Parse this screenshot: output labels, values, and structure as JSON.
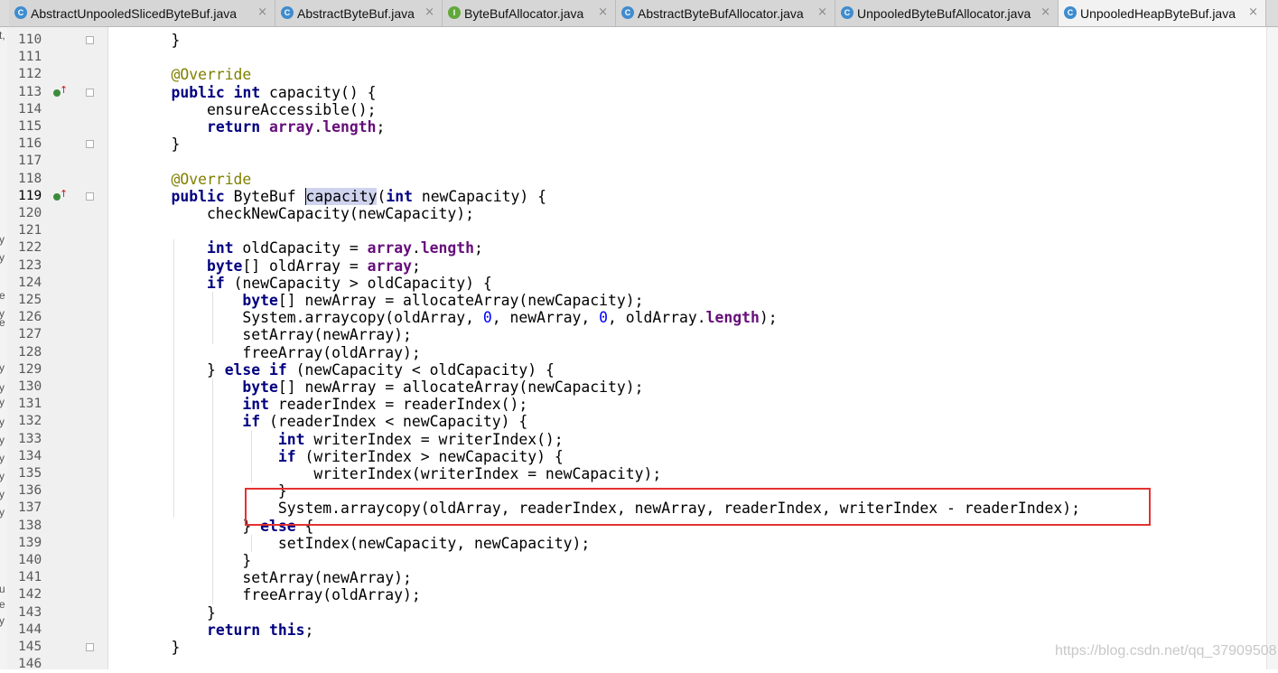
{
  "tabs": [
    {
      "label": "AbstractUnpooledSlicedByteBuf.java",
      "icon": "class-icon",
      "icon_letter": "C",
      "active": false
    },
    {
      "label": "AbstractByteBuf.java",
      "icon": "class-icon",
      "icon_letter": "C",
      "active": false
    },
    {
      "label": "ByteBufAllocator.java",
      "icon": "interface-icon",
      "icon_letter": "I",
      "active": false
    },
    {
      "label": "AbstractByteBufAllocator.java",
      "icon": "class-icon",
      "icon_letter": "C",
      "active": false
    },
    {
      "label": "UnpooledByteBufAllocator.java",
      "icon": "class-icon",
      "icon_letter": "C",
      "active": false
    },
    {
      "label": "UnpooledHeapByteBuf.java",
      "icon": "class-icon",
      "icon_letter": "C",
      "active": true
    }
  ],
  "tab_close_glyph": "×",
  "left_strip_chars": [
    "t,",
    "y",
    "y",
    "e",
    "y",
    "e",
    "y",
    "y",
    "y",
    "y",
    "y",
    "y",
    "y",
    "y",
    "y",
    "u",
    "e",
    "y"
  ],
  "caret_line": 119,
  "highlighted_word": "capacity",
  "override_marker_lines": [
    113,
    119
  ],
  "fold_marker_lines": [
    110,
    113,
    116,
    119,
    145
  ],
  "boxed_line": 137,
  "lines": [
    {
      "n": "110",
      "tokens": [
        [
          "p",
          "    }"
        ]
      ]
    },
    {
      "n": "111",
      "tokens": []
    },
    {
      "n": "112",
      "tokens": [
        [
          "p",
          "    "
        ],
        [
          "ann",
          "@Override"
        ]
      ]
    },
    {
      "n": "113",
      "tokens": [
        [
          "p",
          "    "
        ],
        [
          "kw",
          "public"
        ],
        [
          "p",
          " "
        ],
        [
          "kw",
          "int"
        ],
        [
          "p",
          " capacity() {"
        ]
      ]
    },
    {
      "n": "114",
      "tokens": [
        [
          "p",
          "        ensureAccessible();"
        ]
      ]
    },
    {
      "n": "115",
      "tokens": [
        [
          "p",
          "        "
        ],
        [
          "kw",
          "return"
        ],
        [
          "p",
          " "
        ],
        [
          "fld",
          "array"
        ],
        [
          "p",
          "."
        ],
        [
          "fld",
          "length"
        ],
        [
          "p",
          ";"
        ]
      ]
    },
    {
      "n": "116",
      "tokens": [
        [
          "p",
          "    }"
        ]
      ]
    },
    {
      "n": "117",
      "tokens": []
    },
    {
      "n": "118",
      "tokens": [
        [
          "p",
          "    "
        ],
        [
          "ann",
          "@Override"
        ]
      ]
    },
    {
      "n": "119",
      "tokens": [
        [
          "p",
          "    "
        ],
        [
          "kw",
          "public"
        ],
        [
          "p",
          " ByteBuf "
        ],
        [
          "hl",
          "capacity"
        ],
        [
          "p",
          "("
        ],
        [
          "kw",
          "int"
        ],
        [
          "p",
          " newCapacity) {"
        ]
      ]
    },
    {
      "n": "120",
      "tokens": [
        [
          "p",
          "        checkNewCapacity(newCapacity);"
        ]
      ]
    },
    {
      "n": "121",
      "tokens": []
    },
    {
      "n": "122",
      "tokens": [
        [
          "p",
          "        "
        ],
        [
          "kw",
          "int"
        ],
        [
          "p",
          " oldCapacity = "
        ],
        [
          "fld",
          "array"
        ],
        [
          "p",
          "."
        ],
        [
          "fld",
          "length"
        ],
        [
          "p",
          ";"
        ]
      ]
    },
    {
      "n": "123",
      "tokens": [
        [
          "p",
          "        "
        ],
        [
          "kw",
          "byte"
        ],
        [
          "p",
          "[] oldArray = "
        ],
        [
          "fld",
          "array"
        ],
        [
          "p",
          ";"
        ]
      ]
    },
    {
      "n": "124",
      "tokens": [
        [
          "p",
          "        "
        ],
        [
          "kw",
          "if"
        ],
        [
          "p",
          " (newCapacity > oldCapacity) {"
        ]
      ]
    },
    {
      "n": "125",
      "tokens": [
        [
          "p",
          "            "
        ],
        [
          "kw",
          "byte"
        ],
        [
          "p",
          "[] newArray = allocateArray(newCapacity);"
        ]
      ]
    },
    {
      "n": "126",
      "tokens": [
        [
          "p",
          "            System."
        ],
        [
          "p",
          "arraycopy(oldArray, "
        ],
        [
          "num",
          "0"
        ],
        [
          "p",
          ", newArray, "
        ],
        [
          "num",
          "0"
        ],
        [
          "p",
          ", oldArray."
        ],
        [
          "fld",
          "length"
        ],
        [
          "p",
          ");"
        ]
      ]
    },
    {
      "n": "127",
      "tokens": [
        [
          "p",
          "            setArray(newArray);"
        ]
      ]
    },
    {
      "n": "128",
      "tokens": [
        [
          "p",
          "            freeArray(oldArray);"
        ]
      ]
    },
    {
      "n": "129",
      "tokens": [
        [
          "p",
          "        } "
        ],
        [
          "kw",
          "else if"
        ],
        [
          "p",
          " (newCapacity < oldCapacity) {"
        ]
      ]
    },
    {
      "n": "130",
      "tokens": [
        [
          "p",
          "            "
        ],
        [
          "kw",
          "byte"
        ],
        [
          "p",
          "[] newArray = allocateArray(newCapacity);"
        ]
      ]
    },
    {
      "n": "131",
      "tokens": [
        [
          "p",
          "            "
        ],
        [
          "kw",
          "int"
        ],
        [
          "p",
          " readerIndex = readerIndex();"
        ]
      ]
    },
    {
      "n": "132",
      "tokens": [
        [
          "p",
          "            "
        ],
        [
          "kw",
          "if"
        ],
        [
          "p",
          " (readerIndex < newCapacity) {"
        ]
      ]
    },
    {
      "n": "133",
      "tokens": [
        [
          "p",
          "                "
        ],
        [
          "kw",
          "int"
        ],
        [
          "p",
          " writerIndex = writerIndex();"
        ]
      ]
    },
    {
      "n": "134",
      "tokens": [
        [
          "p",
          "                "
        ],
        [
          "kw",
          "if"
        ],
        [
          "p",
          " (writerIndex > newCapacity) {"
        ]
      ]
    },
    {
      "n": "135",
      "tokens": [
        [
          "p",
          "                    writerIndex(writerIndex = newCapacity);"
        ]
      ]
    },
    {
      "n": "136",
      "tokens": [
        [
          "p",
          "                }"
        ]
      ]
    },
    {
      "n": "137",
      "tokens": [
        [
          "p",
          "                System.arraycopy(oldArray, readerIndex, newArray, readerIndex, writerIndex - readerIndex);"
        ]
      ]
    },
    {
      "n": "138",
      "tokens": [
        [
          "p",
          "            } "
        ],
        [
          "kw",
          "else"
        ],
        [
          "p",
          " {"
        ]
      ]
    },
    {
      "n": "139",
      "tokens": [
        [
          "p",
          "                setIndex(newCapacity, newCapacity);"
        ]
      ]
    },
    {
      "n": "140",
      "tokens": [
        [
          "p",
          "            }"
        ]
      ]
    },
    {
      "n": "141",
      "tokens": [
        [
          "p",
          "            setArray(newArray);"
        ]
      ]
    },
    {
      "n": "142",
      "tokens": [
        [
          "p",
          "            freeArray(oldArray);"
        ]
      ]
    },
    {
      "n": "143",
      "tokens": [
        [
          "p",
          "        }"
        ]
      ]
    },
    {
      "n": "144",
      "tokens": [
        [
          "p",
          "        "
        ],
        [
          "kw",
          "return this"
        ],
        [
          "p",
          ";"
        ]
      ]
    },
    {
      "n": "145",
      "tokens": [
        [
          "p",
          "    }"
        ]
      ]
    },
    {
      "n": "146",
      "tokens": []
    }
  ],
  "watermark": "https://blog.csdn.net/qq_37909508"
}
